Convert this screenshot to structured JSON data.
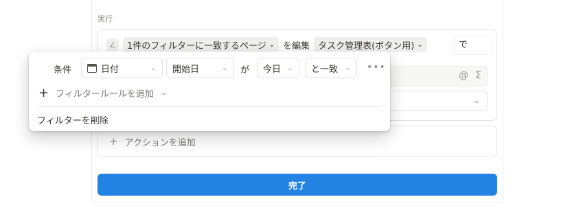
{
  "section": {
    "label": "実行"
  },
  "action": {
    "pages_pill": "1件のフィルターに一致するページ",
    "edit_text": "を編集",
    "db_pill": "タスク管理表(ボタン用)",
    "de_text": "で"
  },
  "input_icons": {
    "at": "@",
    "sigma": "Σ"
  },
  "add_action": {
    "label": "アクションを追加"
  },
  "done_button": {
    "label": "完了"
  },
  "filter": {
    "condition_label": "条件",
    "property": "日付",
    "start": "開始日",
    "ga": "が",
    "value": "今日",
    "operator": "と一致",
    "add_rule": "フィルタールールを追加",
    "delete": "フィルターを削除"
  },
  "icons": {
    "edit": "edit-pencil-icon",
    "calendar": "calendar-icon",
    "plus": "plus-icon",
    "chevron": "chevron-down-icon",
    "more": "more-horizontal-icon"
  },
  "colors": {
    "accent": "#2383e2"
  }
}
